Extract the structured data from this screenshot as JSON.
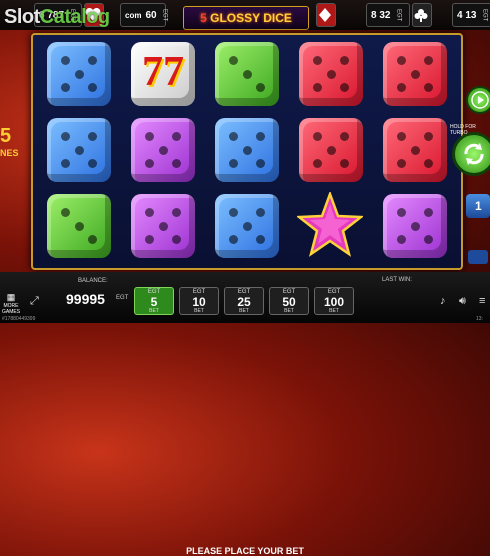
{
  "watermark": {
    "part1": "Slot",
    "part2": "Catalog"
  },
  "game_title": {
    "num": "5",
    "text": "GLOSSY DICE"
  },
  "jackpots": [
    {
      "value": "6 787",
      "currency": "EGT"
    },
    {
      "value": "60",
      "currency": "EGT"
    },
    {
      "value": "8 32",
      "currency": "EGT"
    },
    {
      "value": "4 13",
      "currency": "EGT"
    }
  ],
  "partial_text_top": "com",
  "left_feature": {
    "number": "5",
    "text": "NES"
  },
  "grid": [
    [
      "blue",
      "white7",
      "green",
      "red",
      "red"
    ],
    [
      "blue",
      "purple",
      "blue",
      "red",
      "red"
    ],
    [
      "green",
      "purple",
      "blue",
      "star",
      "purple"
    ]
  ],
  "right_panel": {
    "hold_label": "HOLD FOR TURBO",
    "autoplay_count": "1"
  },
  "bottom": {
    "balance_label": "BALANCE:",
    "balance_value": "99995",
    "balance_currency": "EGT",
    "prompt": "PLEASE PLACE YOUR BET",
    "last_win_label": "LAST WIN:",
    "more_games": "MORE GAMES",
    "footer_id": "#17880449399",
    "time": "13:"
  },
  "bets": [
    {
      "egt": "EGT",
      "value": "5",
      "bet": "BET",
      "active": true
    },
    {
      "egt": "EGT",
      "value": "10",
      "bet": "BET",
      "active": false
    },
    {
      "egt": "EGT",
      "value": "25",
      "bet": "BET",
      "active": false
    },
    {
      "egt": "EGT",
      "value": "50",
      "bet": "BET",
      "active": false
    },
    {
      "egt": "EGT",
      "value": "100",
      "bet": "BET",
      "active": false
    }
  ],
  "icons": [
    "heart-suit-icon",
    "diamond-suit-icon",
    "club-suit-icon",
    "play-icon",
    "refresh-icon",
    "fullscreen-icon",
    "music-icon",
    "speaker-icon",
    "menu-icon"
  ]
}
